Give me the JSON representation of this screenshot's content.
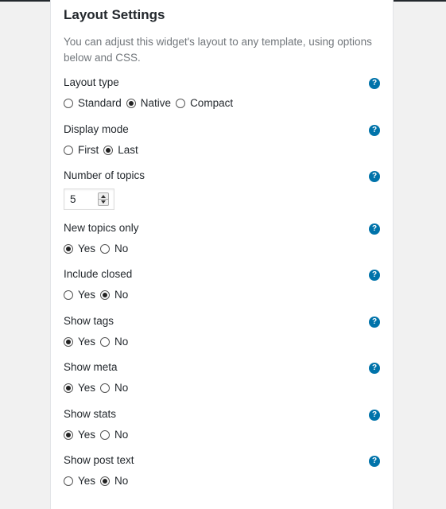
{
  "panel": {
    "title": "Layout Settings",
    "description": "You can adjust this widget's layout to any template, using options below and CSS."
  },
  "settings": {
    "layout_type": {
      "label": "Layout type",
      "help": "?",
      "options": [
        "Standard",
        "Native",
        "Compact"
      ],
      "selected": "Native"
    },
    "display_mode": {
      "label": "Display mode",
      "help": "?",
      "options": [
        "First",
        "Last"
      ],
      "selected": "Last"
    },
    "number_of_topics": {
      "label": "Number of topics",
      "help": "?",
      "value": "5"
    },
    "new_topics_only": {
      "label": "New topics only",
      "help": "?",
      "options": [
        "Yes",
        "No"
      ],
      "selected": "Yes"
    },
    "include_closed": {
      "label": "Include closed",
      "help": "?",
      "options": [
        "Yes",
        "No"
      ],
      "selected": "No"
    },
    "show_tags": {
      "label": "Show tags",
      "help": "?",
      "options": [
        "Yes",
        "No"
      ],
      "selected": "Yes"
    },
    "show_meta": {
      "label": "Show meta",
      "help": "?",
      "options": [
        "Yes",
        "No"
      ],
      "selected": "Yes"
    },
    "show_stats": {
      "label": "Show stats",
      "help": "?",
      "options": [
        "Yes",
        "No"
      ],
      "selected": "Yes"
    },
    "show_post_text": {
      "label": "Show post text",
      "help": "?",
      "options": [
        "Yes",
        "No"
      ],
      "selected": "No"
    }
  },
  "colors": {
    "help_icon": "#0073aa",
    "top_bar": "#23282d",
    "background": "#f1f1f1"
  }
}
